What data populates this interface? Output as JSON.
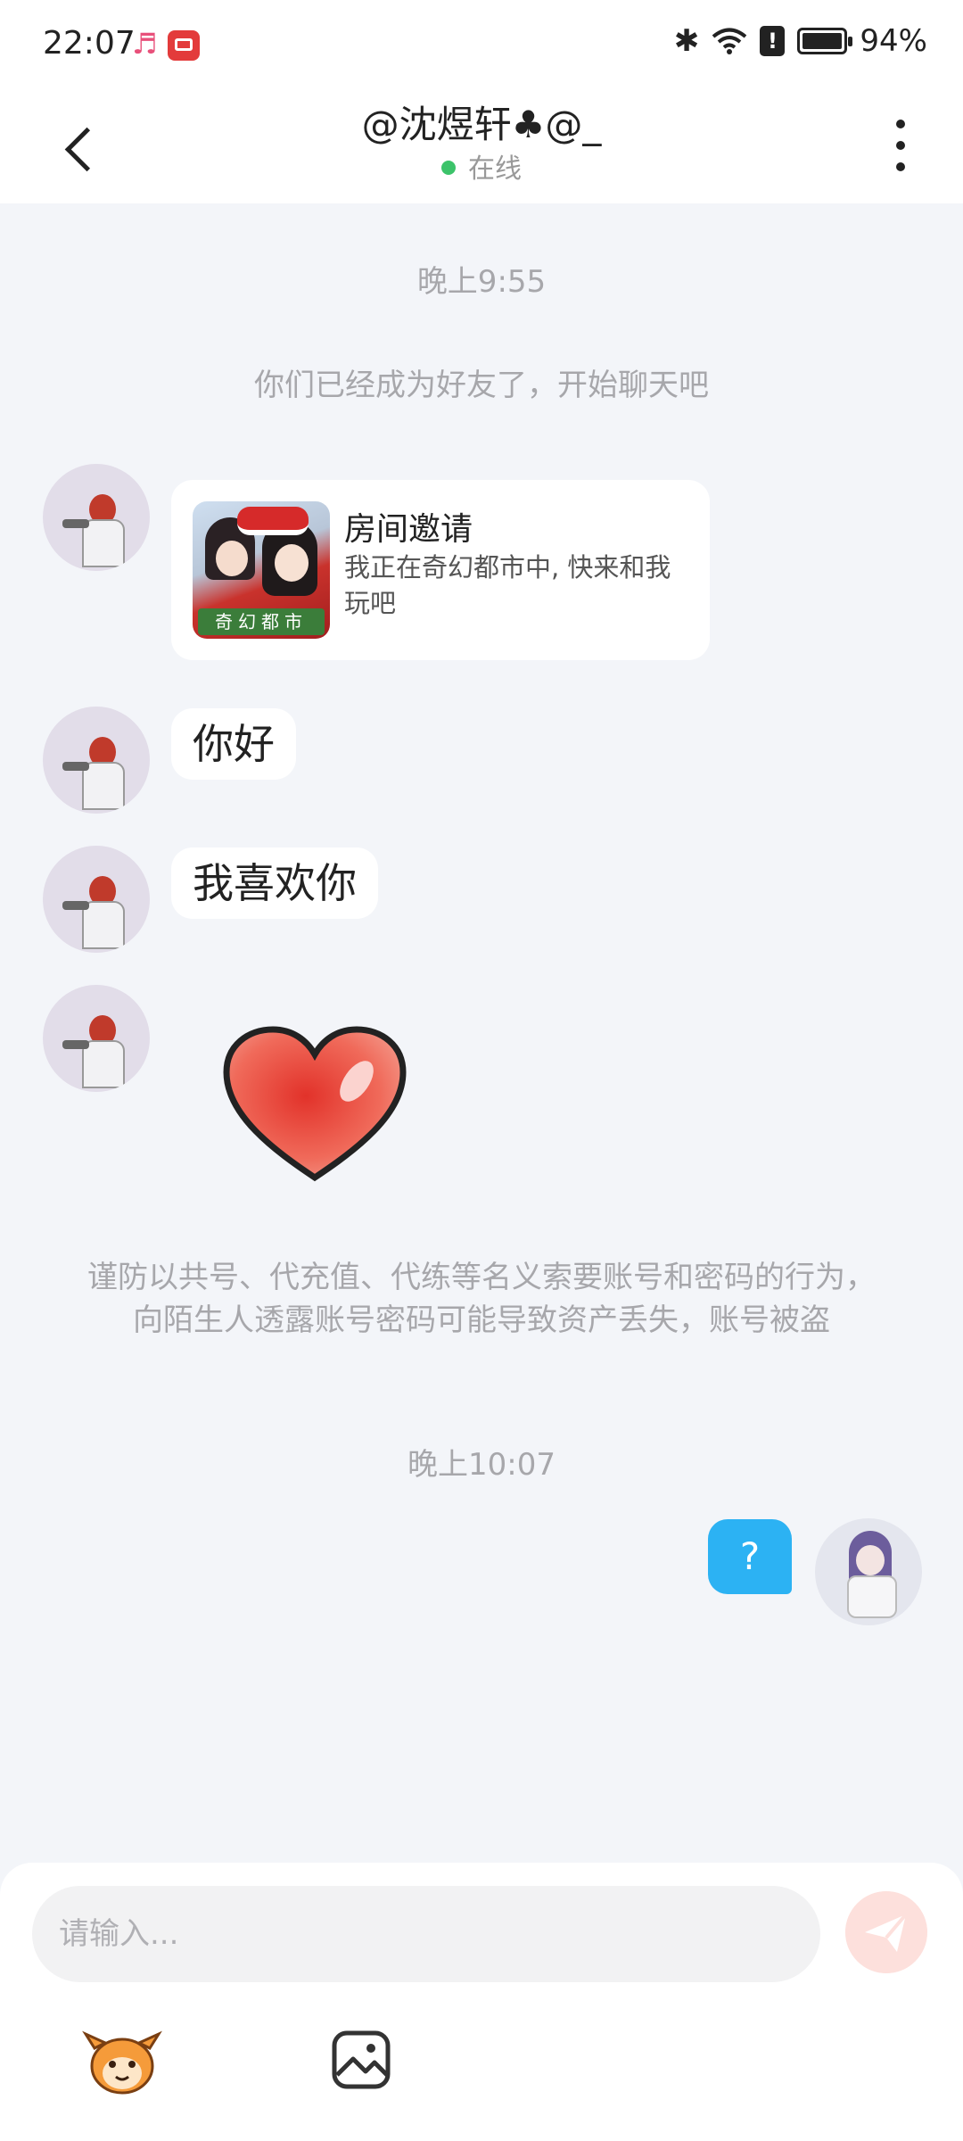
{
  "status_bar": {
    "time": "22:07",
    "battery": "94%",
    "icons": [
      "music-icon",
      "app-notification-icon",
      "bluetooth-icon",
      "wifi-icon",
      "alert-icon",
      "battery-icon"
    ]
  },
  "header": {
    "title": "@沈煜轩♣@_",
    "status": "在线",
    "status_color": "#3cc36a"
  },
  "messages": {
    "timestamp_1": "晚上9:55",
    "system_notice": "你们已经成为好友了，开始聊天吧",
    "invite": {
      "title": "房间邀请",
      "description": "我正在奇幻都市中, 快来和我玩吧",
      "thumb_label": "奇幻都市"
    },
    "text_1": "你好",
    "text_2": "我喜欢你",
    "sticker": "heart-sticker",
    "warning_line_1": "谨防以共号、代充值、代练等名义索要账号和密码的行为，",
    "warning_line_2": "向陌生人透露账号密码可能导致资产丢失，账号被盗",
    "timestamp_2": "晚上10:07",
    "my_message": "?"
  },
  "composer": {
    "placeholder": "请输入...",
    "send_color": "#fde0dc",
    "accent": "#2cb2f3"
  }
}
